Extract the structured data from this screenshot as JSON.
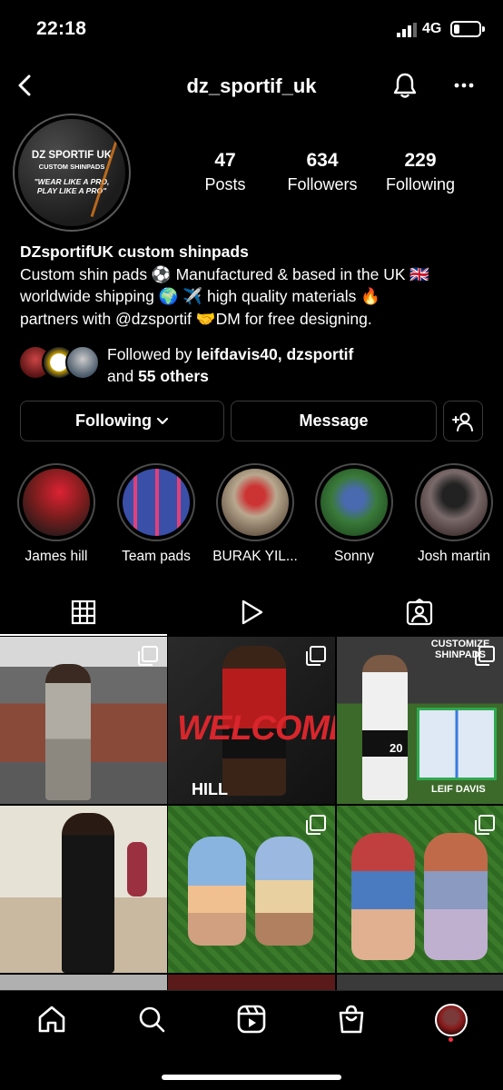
{
  "status_bar": {
    "time": "22:18",
    "network": "4G"
  },
  "header": {
    "username": "dz_sportif_uk"
  },
  "avatar": {
    "line1": "DZ SPORTIF UK",
    "line2": "CUSTOM SHINPADS",
    "line3": "\"WEAR LIKE A PRO,",
    "line4": "PLAY LIKE A PRO\""
  },
  "stats": [
    {
      "value": "47",
      "label": "Posts"
    },
    {
      "value": "634",
      "label": "Followers"
    },
    {
      "value": "229",
      "label": "Following"
    }
  ],
  "bio": {
    "name": "DZsportifUK custom shinpads",
    "line1": "Custom shin pads ⚽ Manufactured & based in the UK 🇬🇧",
    "line2": "worldwide shipping 🌍 ✈️ high quality materials 🔥",
    "line3": "partners with @dzsportif 🤝DM for free designing."
  },
  "followed_by": {
    "prefix": "Followed by ",
    "users": "leifdavis40, dzsportif",
    "and": "and ",
    "others": "55 others"
  },
  "buttons": {
    "following": "Following",
    "message": "Message"
  },
  "highlights": [
    {
      "label": "James hill",
      "color": "#7a1d1d"
    },
    {
      "label": "Team pads",
      "color": "#3a4fa8"
    },
    {
      "label": "BURAK YIL...",
      "color": "#8a7a6a"
    },
    {
      "label": "Sonny",
      "color": "#2f6b2f"
    },
    {
      "label": "Josh martin",
      "color": "#5a4a4a"
    }
  ],
  "grid_text": {
    "post2_title": "WELCOME",
    "post2_name": "HILL",
    "post3_title": "CUSTOMIZE SHINPADS",
    "post3_name": "LEIF DAVIS",
    "post3_number": "20"
  },
  "colors": {
    "accent": "#ffffff",
    "background": "#000000",
    "notification": "#ff3040",
    "welcome_red": "#d8262c"
  }
}
